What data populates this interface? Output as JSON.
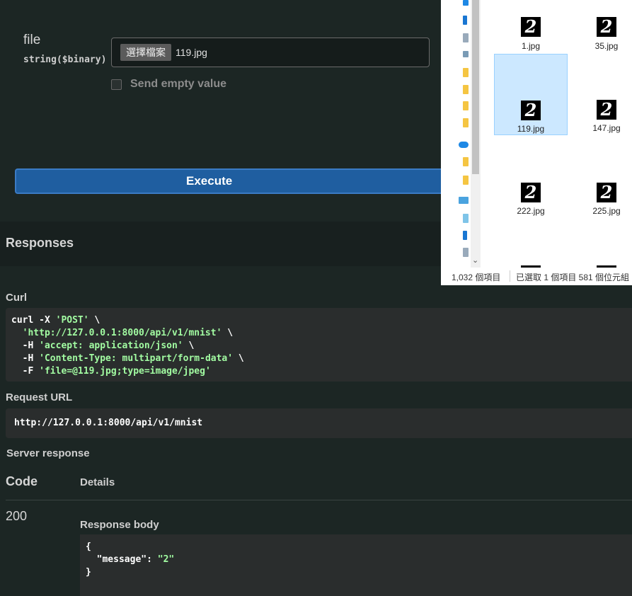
{
  "parameter": {
    "name": "file",
    "type": "string($binary)",
    "choose_button": "選擇檔案",
    "file_name": "119.jpg",
    "send_empty_label": "Send empty value"
  },
  "execute_label": "Execute",
  "responses": {
    "title": "Responses",
    "curl_label": "Curl",
    "curl_lines": [
      {
        "plain": "curl -X ",
        "str": "'POST'",
        "tail": " \\"
      },
      {
        "plain": "  ",
        "str": "'http://127.0.0.1:8000/api/v1/mnist'",
        "tail": " \\"
      },
      {
        "plain": "  -H ",
        "str": "'accept: application/json'",
        "tail": " \\"
      },
      {
        "plain": "  -H ",
        "str": "'Content-Type: multipart/form-data'",
        "tail": " \\"
      },
      {
        "plain": "  -F ",
        "str": "'file=@119.jpg;type=image/jpeg'",
        "tail": ""
      }
    ],
    "request_url_label": "Request URL",
    "request_url": "http://127.0.0.1:8000/api/v1/mnist",
    "server_response_label": "Server response",
    "code_header": "Code",
    "details_header": "Details",
    "code": "200",
    "response_body_label": "Response body",
    "response_body": {
      "open": "{",
      "key": "  \"message\": ",
      "value": "\"2\"",
      "close": "}"
    }
  },
  "explorer": {
    "files": [
      {
        "name": "1.jpg",
        "digit": "2",
        "selected": false
      },
      {
        "name": "35.jpg",
        "digit": "2",
        "selected": false
      },
      {
        "name": "119.jpg",
        "digit": "2",
        "selected": true
      },
      {
        "name": "147.jpg",
        "digit": "2",
        "selected": false
      },
      {
        "name": "222.jpg",
        "digit": "2",
        "selected": false
      },
      {
        "name": "225.jpg",
        "digit": "2",
        "selected": false
      }
    ],
    "status_count": "1,032 個項目",
    "status_selected": "已選取 1 個項目  581 個位元組"
  },
  "colors": {
    "accent": "#1f5ea0",
    "code_string": "#a2fca2",
    "selection": "#cce8ff"
  }
}
